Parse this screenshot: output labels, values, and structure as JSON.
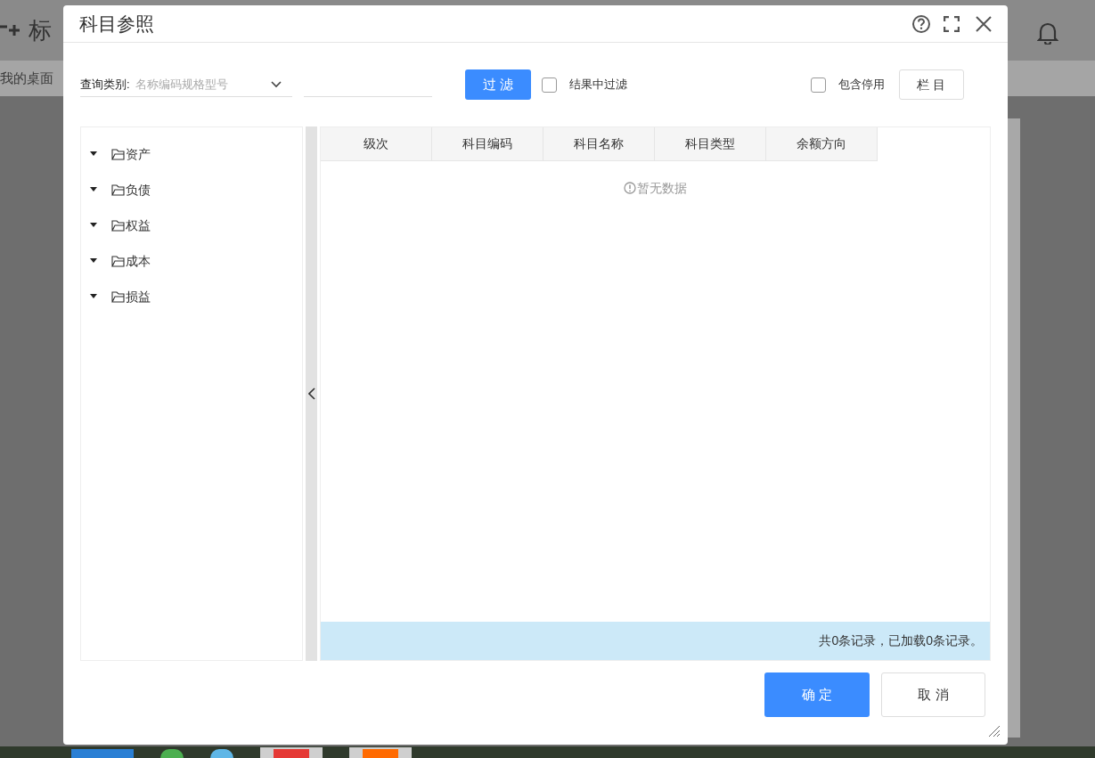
{
  "background": {
    "logo_text": "标",
    "tab": "我的桌面"
  },
  "dialog": {
    "title": "科目参照",
    "toolbar": {
      "query_label": "查询类别:",
      "query_placeholder": "名称编码规格型号",
      "filter_button": "过滤",
      "filter_in_results": {
        "label": "结果中过滤",
        "checked": false
      },
      "include_disabled": {
        "label": "包含停用",
        "checked": false
      },
      "columns_button": "栏目"
    },
    "tree": [
      {
        "label": "资产",
        "expanded": true
      },
      {
        "label": "负债",
        "expanded": true
      },
      {
        "label": "权益",
        "expanded": true
      },
      {
        "label": "成本",
        "expanded": true
      },
      {
        "label": "损益",
        "expanded": true
      }
    ],
    "table": {
      "columns": [
        "级次",
        "科目编码",
        "科目名称",
        "科目类型",
        "余额方向"
      ],
      "empty_text": "暂无数据",
      "status": "共0条记录，已加载0条记录。"
    },
    "buttons": {
      "ok": "确定",
      "cancel": "取消"
    }
  }
}
